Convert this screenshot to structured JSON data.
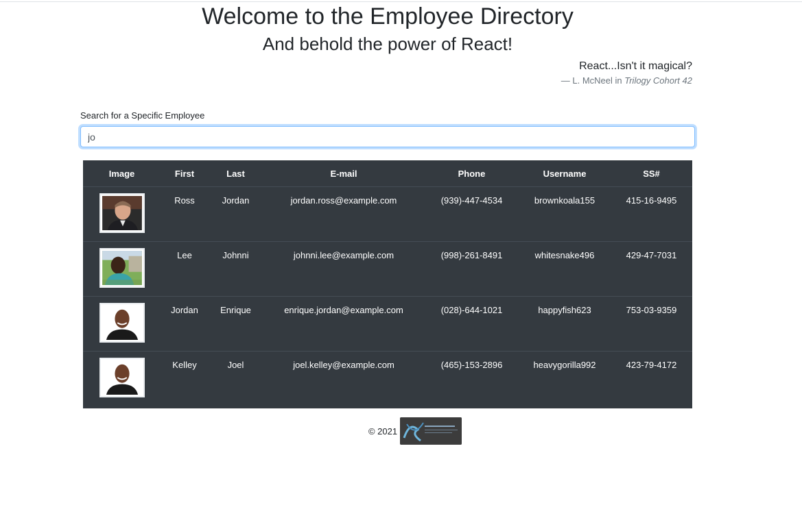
{
  "header": {
    "title": "Welcome to the Employee Directory",
    "subtitle": "And behold the power of React!"
  },
  "quote": {
    "text": "React...Isn't it magical?",
    "attribution_prefix": "— L. McNeel in",
    "source": "Trilogy Cohort 42"
  },
  "search": {
    "label": "Search for a Specific Employee",
    "value": "jo",
    "placeholder": ""
  },
  "table": {
    "headers": [
      "Image",
      "First",
      "Last",
      "E-mail",
      "Phone",
      "Username",
      "SS#"
    ],
    "rows": [
      {
        "first": "Ross",
        "last": "Jordan",
        "email": "jordan.ross@example.com",
        "phone": "(939)-447-4534",
        "username": "brownkoala155",
        "ssn": "415-16-9495",
        "photo": "employee-photo"
      },
      {
        "first": "Lee",
        "last": "Johnni",
        "email": "johnni.lee@example.com",
        "phone": "(998)-261-8491",
        "username": "whitesnake496",
        "ssn": "429-47-7031",
        "photo": "employee-photo"
      },
      {
        "first": "Jordan",
        "last": "Enrique",
        "email": "enrique.jordan@example.com",
        "phone": "(028)-644-1021",
        "username": "happyfish623",
        "ssn": "753-03-9359",
        "photo": "employee-photo"
      },
      {
        "first": "Kelley",
        "last": "Joel",
        "email": "joel.kelley@example.com",
        "phone": "(465)-153-2896",
        "username": "heavygorilla992",
        "ssn": "423-79-4172",
        "photo": "employee-photo"
      }
    ]
  },
  "footer": {
    "copyright": "© 2021",
    "logo_icon": "company-logo"
  },
  "colors": {
    "table_bg": "#343a40",
    "table_border": "#454d55",
    "input_focus": "#80bdff",
    "muted_text": "#6c757d"
  }
}
